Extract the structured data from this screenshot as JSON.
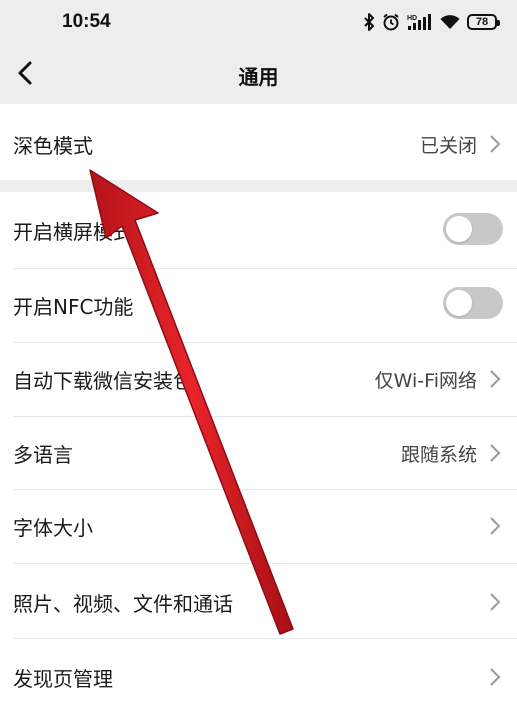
{
  "status_bar": {
    "time": "10:54",
    "icons": [
      "bluetooth-icon",
      "alarm-icon",
      "hd-signal-icon",
      "wifi-icon"
    ],
    "battery": "78"
  },
  "nav": {
    "back_icon": "chevron-left-icon",
    "title": "通用"
  },
  "settings": {
    "dark_mode": {
      "label": "深色模式",
      "value": "已关闭"
    },
    "landscape": {
      "label": "开启横屏模式",
      "toggle_on": false
    },
    "nfc": {
      "label": "开启NFC功能",
      "toggle_on": false
    },
    "auto_download": {
      "label": "自动下载微信安装包",
      "value": "仅Wi-Fi网络"
    },
    "language": {
      "label": "多语言",
      "value": "跟随系统"
    },
    "font_size": {
      "label": "字体大小"
    },
    "media": {
      "label": "照片、视频、文件和通话"
    },
    "discover": {
      "label": "发现页管理"
    }
  },
  "colors": {
    "background": "#ffffff",
    "header": "#ededed",
    "toggle_off": "#c8c8c8",
    "annotation_arrow": "#d9191f"
  }
}
